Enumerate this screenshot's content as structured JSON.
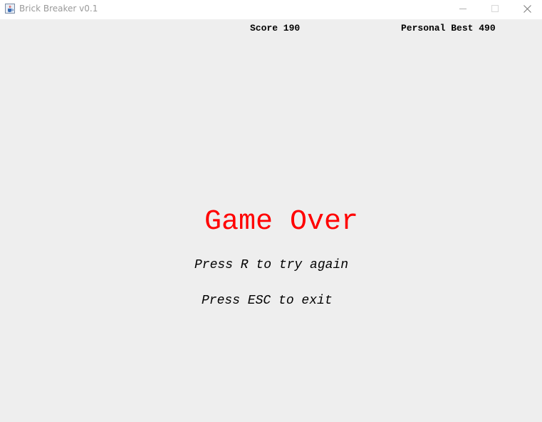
{
  "window": {
    "title": "Brick Breaker v0.1",
    "icon": "java-cup-icon"
  },
  "hud": {
    "score_text": "Score 190",
    "best_text": "Personal Best 490"
  },
  "game": {
    "status_text": "Game Over",
    "retry_text": "Press R to try again",
    "exit_text": "Press ESC to exit"
  },
  "colors": {
    "background": "#eeeeee",
    "game_over": "#ff0000",
    "text": "#000000"
  }
}
